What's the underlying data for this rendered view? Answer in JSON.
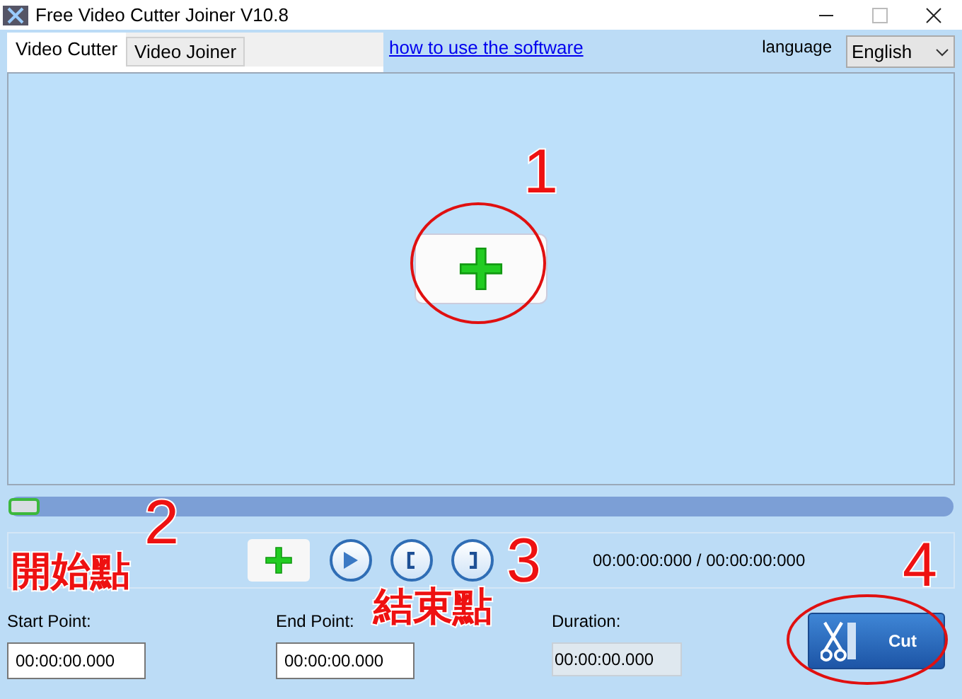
{
  "window": {
    "title": "Free Video Cutter Joiner V10.8"
  },
  "tabs": [
    {
      "label": "Video Cutter",
      "selected": true
    },
    {
      "label": "Video Joiner",
      "selected": false
    }
  ],
  "help_link": "how to use the software",
  "language": {
    "label": "language",
    "value": "English"
  },
  "progress": {
    "level": 0
  },
  "time_display": "00:00:00:000 / 00:00:00:000",
  "fields": [
    {
      "label": "Start Point:",
      "value": "00:00:00.000",
      "disabled": false
    },
    {
      "label": "End Point:",
      "value": "00:00:00.000",
      "disabled": false
    },
    {
      "label": "Duration:",
      "value": "00:00:00.000",
      "disabled": true
    }
  ],
  "cut_button": "Cut",
  "annotations": [
    {
      "kind": "number",
      "text": "1"
    },
    {
      "kind": "number",
      "text": "2"
    },
    {
      "kind": "caption",
      "text": "開始點"
    },
    {
      "kind": "number",
      "text": "3"
    },
    {
      "kind": "caption",
      "text": "結束點"
    },
    {
      "kind": "number",
      "text": "4"
    }
  ]
}
